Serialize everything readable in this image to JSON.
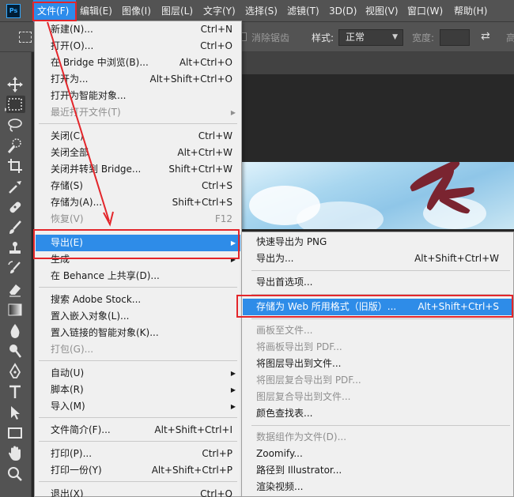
{
  "app": {
    "logo_text": "Ps"
  },
  "menubar": {
    "items": [
      {
        "label": "文件(F)"
      },
      {
        "label": "编辑(E)"
      },
      {
        "label": "图像(I)"
      },
      {
        "label": "图层(L)"
      },
      {
        "label": "文字(Y)"
      },
      {
        "label": "选择(S)"
      },
      {
        "label": "滤镜(T)"
      },
      {
        "label": "3D(D)"
      },
      {
        "label": "视图(V)"
      },
      {
        "label": "窗口(W)"
      },
      {
        "label": "帮助(H)"
      }
    ],
    "active_index": 0
  },
  "options_bar": {
    "antialias_label": "消除锯齿",
    "style_label": "样式:",
    "style_value": "正常",
    "width_label": "宽度:",
    "height_label": "高"
  },
  "file_menu": {
    "items": [
      {
        "label": "新建(N)...",
        "shortcut": "Ctrl+N",
        "disabled": false
      },
      {
        "label": "打开(O)...",
        "shortcut": "Ctrl+O",
        "disabled": false
      },
      {
        "label": "在 Bridge 中浏览(B)...",
        "shortcut": "Alt+Ctrl+O",
        "disabled": false
      },
      {
        "label": "打开为...",
        "shortcut": "Alt+Shift+Ctrl+O",
        "disabled": false
      },
      {
        "label": "打开为智能对象...",
        "shortcut": "",
        "disabled": false
      },
      {
        "label": "最近打开文件(T)",
        "shortcut": "",
        "disabled": true,
        "submenu": true
      },
      {
        "label": "关闭(C)",
        "shortcut": "Ctrl+W",
        "disabled": false
      },
      {
        "label": "关闭全部",
        "shortcut": "Alt+Ctrl+W",
        "disabled": false
      },
      {
        "label": "关闭并转到 Bridge...",
        "shortcut": "Shift+Ctrl+W",
        "disabled": false
      },
      {
        "label": "存储(S)",
        "shortcut": "Ctrl+S",
        "disabled": false
      },
      {
        "label": "存储为(A)...",
        "shortcut": "Shift+Ctrl+S",
        "disabled": false
      },
      {
        "label": "恢复(V)",
        "shortcut": "F12",
        "disabled": true
      },
      {
        "label": "导出(E)",
        "shortcut": "",
        "disabled": false,
        "submenu": true,
        "highlight": true
      },
      {
        "label": "生成",
        "shortcut": "",
        "disabled": false,
        "submenu": true
      },
      {
        "label": "在 Behance 上共享(D)...",
        "shortcut": "",
        "disabled": false
      },
      {
        "label": "搜索 Adobe Stock...",
        "shortcut": "",
        "disabled": false
      },
      {
        "label": "置入嵌入对象(L)...",
        "shortcut": "",
        "disabled": false
      },
      {
        "label": "置入链接的智能对象(K)...",
        "shortcut": "",
        "disabled": false
      },
      {
        "label": "打包(G)...",
        "shortcut": "",
        "disabled": true
      },
      {
        "label": "自动(U)",
        "shortcut": "",
        "disabled": false,
        "submenu": true
      },
      {
        "label": "脚本(R)",
        "shortcut": "",
        "disabled": false,
        "submenu": true
      },
      {
        "label": "导入(M)",
        "shortcut": "",
        "disabled": false,
        "submenu": true
      },
      {
        "label": "文件简介(F)...",
        "shortcut": "Alt+Shift+Ctrl+I",
        "disabled": false
      },
      {
        "label": "打印(P)...",
        "shortcut": "Ctrl+P",
        "disabled": false
      },
      {
        "label": "打印一份(Y)",
        "shortcut": "Alt+Shift+Ctrl+P",
        "disabled": false
      },
      {
        "label": "退出(X)",
        "shortcut": "Ctrl+Q",
        "disabled": false
      }
    ]
  },
  "export_menu": {
    "items": [
      {
        "label": "快速导出为 PNG",
        "shortcut": "",
        "disabled": false
      },
      {
        "label": "导出为...",
        "shortcut": "Alt+Shift+Ctrl+W",
        "disabled": false
      },
      {
        "label": "导出首选项...",
        "shortcut": "",
        "disabled": false
      },
      {
        "label": "存储为 Web 所用格式（旧版）...",
        "shortcut": "Alt+Shift+Ctrl+S",
        "disabled": false,
        "highlight": true
      },
      {
        "label": "画板至文件...",
        "shortcut": "",
        "disabled": true
      },
      {
        "label": "将画板导出到 PDF...",
        "shortcut": "",
        "disabled": true
      },
      {
        "label": "将图层导出到文件...",
        "shortcut": "",
        "disabled": false
      },
      {
        "label": "将图层复合导出到 PDF...",
        "shortcut": "",
        "disabled": true
      },
      {
        "label": "图层复合导出到文件...",
        "shortcut": "",
        "disabled": true
      },
      {
        "label": "颜色查找表...",
        "shortcut": "",
        "disabled": false
      },
      {
        "label": "数据组作为文件(D)...",
        "shortcut": "",
        "disabled": true
      },
      {
        "label": "Zoomify...",
        "shortcut": "",
        "disabled": false
      },
      {
        "label": "路径到 Illustrator...",
        "shortcut": "",
        "disabled": false
      },
      {
        "label": "渲染视频...",
        "shortcut": "",
        "disabled": false
      }
    ]
  },
  "colors": {
    "highlight": "#2e8ce8",
    "annotation": "#e3262b"
  }
}
